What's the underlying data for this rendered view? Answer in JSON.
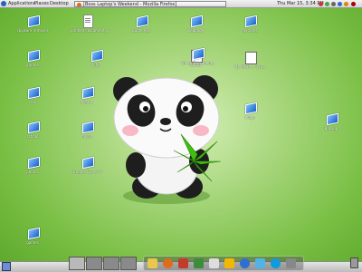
{
  "top_panel": {
    "menus": [
      "Applications",
      "Places",
      "Desktop"
    ],
    "task_title": "[Boss Laptop's Weekend - Mozilla Firefox]",
    "datetime": "Thu Mar 15,   3:34 PM"
  },
  "desktop_icons": [
    {
      "name": "spyware-folder-icon",
      "label": "spyware remover",
      "type": "box"
    },
    {
      "name": "untitled-doc-icon",
      "label": "untitled_document_3",
      "type": "doc"
    },
    {
      "name": "quote-box-icon",
      "label": "quote.eps",
      "type": "box"
    },
    {
      "name": "webpage-box-icon",
      "label": "webpage",
      "type": "box"
    },
    {
      "name": "gnome-box-icon",
      "label": "gnome",
      "type": "box"
    },
    {
      "name": "dl-box-icon",
      "label": "dl.txt",
      "type": "box"
    },
    {
      "name": "cd-txt-icon",
      "label": "CD.txt",
      "type": "txt"
    },
    {
      "name": "favorites-box-icon",
      "label": "favorites",
      "type": "box"
    },
    {
      "name": "cool-box-icon",
      "label": "cool",
      "type": "box"
    },
    {
      "name": "file-box-icon",
      "label": "file.txt",
      "type": "box"
    },
    {
      "name": "mp-txt-icon",
      "label": "My MP3s + lyrics",
      "type": "txt"
    },
    {
      "name": "school-box-icon",
      "label": "school",
      "type": "box"
    },
    {
      "name": "music-box-icon",
      "label": "music",
      "type": "box"
    },
    {
      "name": "blogs-box-icon",
      "label": "blogs",
      "type": "box"
    },
    {
      "name": "backup-box-icon",
      "label": "Backup",
      "type": "box"
    },
    {
      "name": "photos-box-icon",
      "label": "photos",
      "type": "box"
    },
    {
      "name": "dreams-box-icon",
      "label": "Dreams Gone FX",
      "type": "box"
    },
    {
      "name": "games-box-icon",
      "label": "games",
      "type": "box"
    },
    {
      "name": "documents-link-icon",
      "label": "link to Documents",
      "type": "box"
    }
  ],
  "dock_icons": [
    "folder-icon",
    "firefox-icon",
    "music-icon",
    "network-icon",
    "email-icon",
    "aim-icon",
    "globe-icon",
    "chat-icon",
    "skype-icon",
    "gear-icon"
  ],
  "colors": {
    "desktop_green": "#79bf44",
    "panel_gray": "#d6d6d6",
    "icon_blue": "#1a5fc7",
    "leaf_green": "#3fbf10"
  }
}
